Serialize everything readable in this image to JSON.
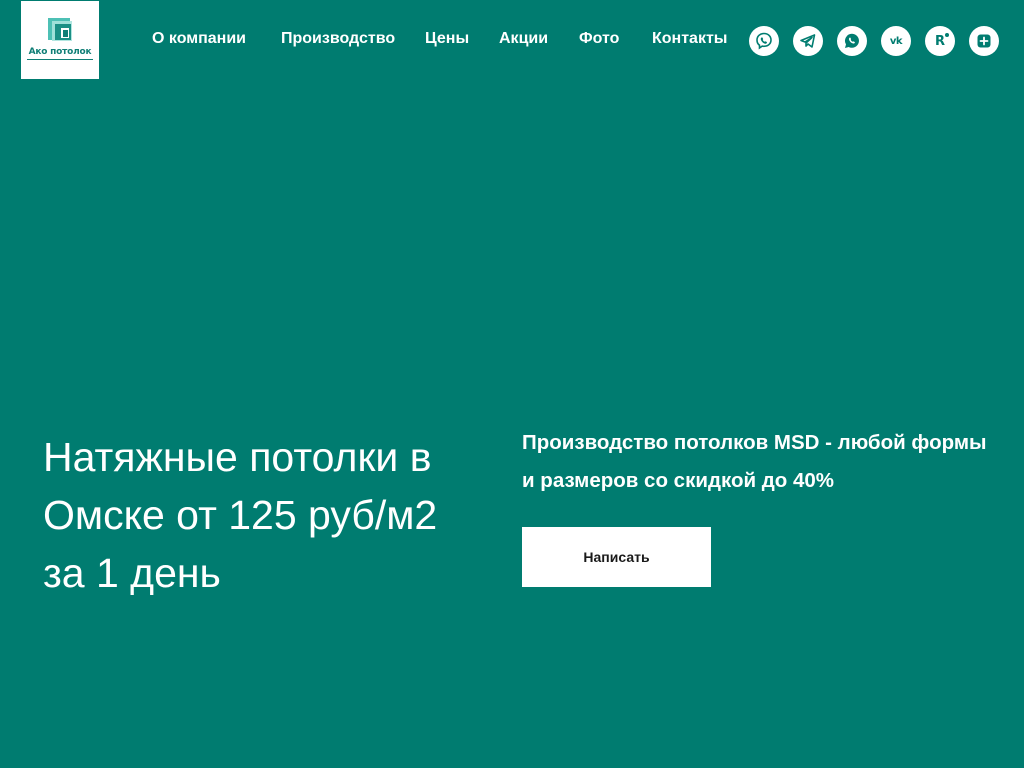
{
  "logo": {
    "text": "Ако потолок",
    "icon": "logo-squares-icon"
  },
  "nav": {
    "items": [
      {
        "label": "О компании"
      },
      {
        "label": "Производство"
      },
      {
        "label": "Цены"
      },
      {
        "label": "Акции"
      },
      {
        "label": "Фото"
      },
      {
        "label": "Контакты"
      }
    ]
  },
  "social": {
    "items": [
      {
        "icon": "viber-icon"
      },
      {
        "icon": "telegram-icon"
      },
      {
        "icon": "whatsapp-icon"
      },
      {
        "icon": "vk-icon",
        "text": "vk"
      },
      {
        "icon": "rutube-icon",
        "text": "R"
      },
      {
        "icon": "plus-icon"
      }
    ]
  },
  "hero": {
    "title": "Натяжные потолки в Омске от 125 руб/м2 за 1 день",
    "subtitle": "Производство потолков MSD - любой формы и размеров со скидкой до 40%",
    "cta_label": "Написать"
  },
  "colors": {
    "background": "#007c70",
    "text": "#ffffff",
    "button_bg": "#ffffff",
    "button_text": "#1a1a1a",
    "logo_teal": "#0f7e76"
  }
}
